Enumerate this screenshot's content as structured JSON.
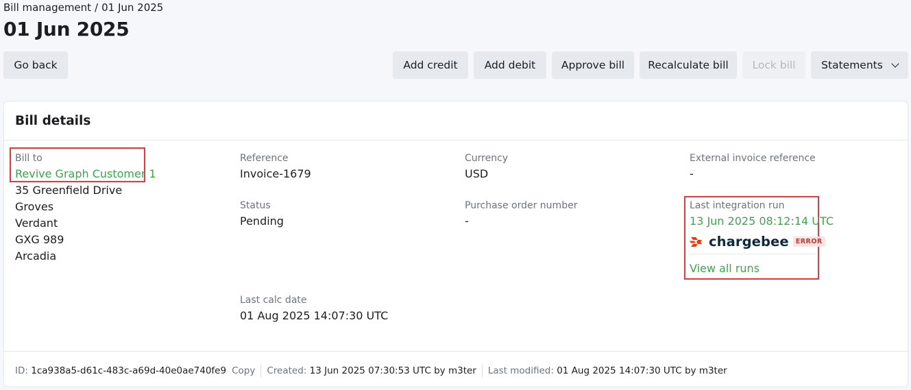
{
  "breadcrumb": {
    "parent": "Bill management",
    "separator": "/",
    "current": "01 Jun 2025"
  },
  "page_title": "01 Jun 2025",
  "toolbar": {
    "go_back": "Go back",
    "add_credit": "Add credit",
    "add_debit": "Add debit",
    "approve_bill": "Approve bill",
    "recalculate_bill": "Recalculate bill",
    "lock_bill": "Lock bill",
    "statements": "Statements"
  },
  "card": {
    "title": "Bill details",
    "bill_to": {
      "label": "Bill to",
      "customer": "Revive Graph Customer 1",
      "address": [
        "35 Greenfield Drive",
        "Groves",
        "Verdant",
        "GXG 989",
        "Arcadia"
      ]
    },
    "reference": {
      "label": "Reference",
      "value": "Invoice-1679"
    },
    "status": {
      "label": "Status",
      "value": "Pending"
    },
    "last_calc": {
      "label": "Last calc date",
      "value": "01 Aug 2025 14:07:30 UTC"
    },
    "currency": {
      "label": "Currency",
      "value": "USD"
    },
    "po_number": {
      "label": "Purchase order number",
      "value": "-"
    },
    "external_ref": {
      "label": "External invoice reference",
      "value": "-"
    },
    "integration": {
      "label": "Last integration run",
      "timestamp": "13 Jun 2025 08:12:14 UTC",
      "provider": "chargebee",
      "badge": "ERROR",
      "view_all": "View all runs"
    },
    "footer": {
      "id_label": "ID:",
      "id_value": "1ca938a5-d61c-483c-a69d-40e0ae740fe9",
      "copy": "Copy",
      "created_label": "Created:",
      "created_value": "13 Jun 2025 07:30:53 UTC by m3ter",
      "modified_label": "Last modified:",
      "modified_value": "01 Aug 2025 14:07:30 UTC by m3ter"
    }
  },
  "colors": {
    "link": "#3aa84a",
    "highlight": "#e5383b",
    "chargebee_brand": "#ff3300",
    "error_badge_bg": "#fde2e2"
  },
  "icons": {
    "chargebee_logo": "chargebee-logo-icon",
    "statements_dropdown": "chevron-down-icon"
  }
}
